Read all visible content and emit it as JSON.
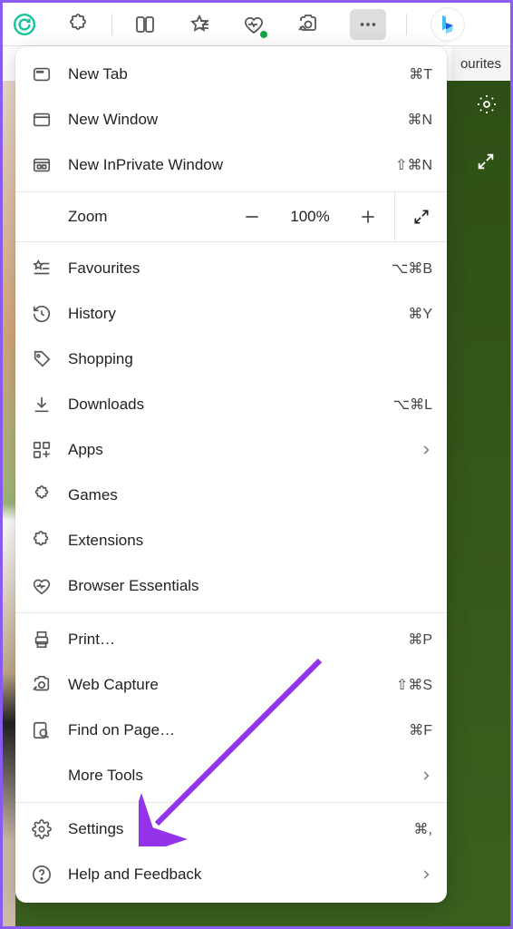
{
  "toolbar": {
    "icons": [
      "grammarly",
      "extension",
      "split",
      "favourites",
      "heartbeat",
      "capture",
      "more",
      "bing"
    ]
  },
  "subbar": {
    "text": "ourites"
  },
  "menu": {
    "new_tab": {
      "label": "New Tab",
      "shortcut": "⌘T"
    },
    "new_window": {
      "label": "New Window",
      "shortcut": "⌘N"
    },
    "new_inprivate": {
      "label": "New InPrivate Window",
      "shortcut": "⇧⌘N"
    },
    "zoom": {
      "label": "Zoom",
      "value": "100%"
    },
    "favourites": {
      "label": "Favourites",
      "shortcut": "⌥⌘B"
    },
    "history": {
      "label": "History",
      "shortcut": "⌘Y"
    },
    "shopping": {
      "label": "Shopping"
    },
    "downloads": {
      "label": "Downloads",
      "shortcut": "⌥⌘L"
    },
    "apps": {
      "label": "Apps"
    },
    "games": {
      "label": "Games"
    },
    "extensions": {
      "label": "Extensions"
    },
    "browser_essentials": {
      "label": "Browser Essentials"
    },
    "print": {
      "label": "Print…",
      "shortcut": "⌘P"
    },
    "web_capture": {
      "label": "Web Capture",
      "shortcut": "⇧⌘S"
    },
    "find": {
      "label": "Find on Page…",
      "shortcut": "⌘F"
    },
    "more_tools": {
      "label": "More Tools"
    },
    "settings": {
      "label": "Settings",
      "shortcut": "⌘,"
    },
    "help": {
      "label": "Help and Feedback"
    }
  }
}
